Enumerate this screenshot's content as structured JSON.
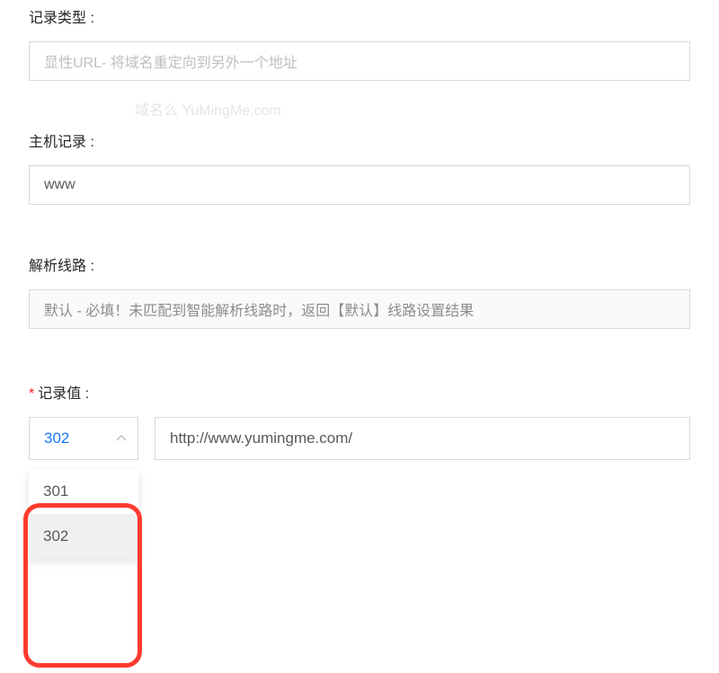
{
  "form": {
    "record_type": {
      "label": "记录类型 :",
      "value": "显性URL- 将域名重定向到另外一个地址"
    },
    "host_record": {
      "label": "主机记录 :",
      "value": "www"
    },
    "resolution_line": {
      "label": "解析线路 :",
      "placeholder": "默认 - 必填！未匹配到智能解析线路时，返回【默认】线路设置结果"
    },
    "record_value": {
      "label": "记录值 :",
      "required_mark": "*",
      "selected_code": "302",
      "options": [
        "301",
        "302"
      ],
      "url": "http://www.yumingme.com/"
    }
  },
  "watermark": {
    "cn": "域名么",
    "en": "YuMingMe.com"
  }
}
